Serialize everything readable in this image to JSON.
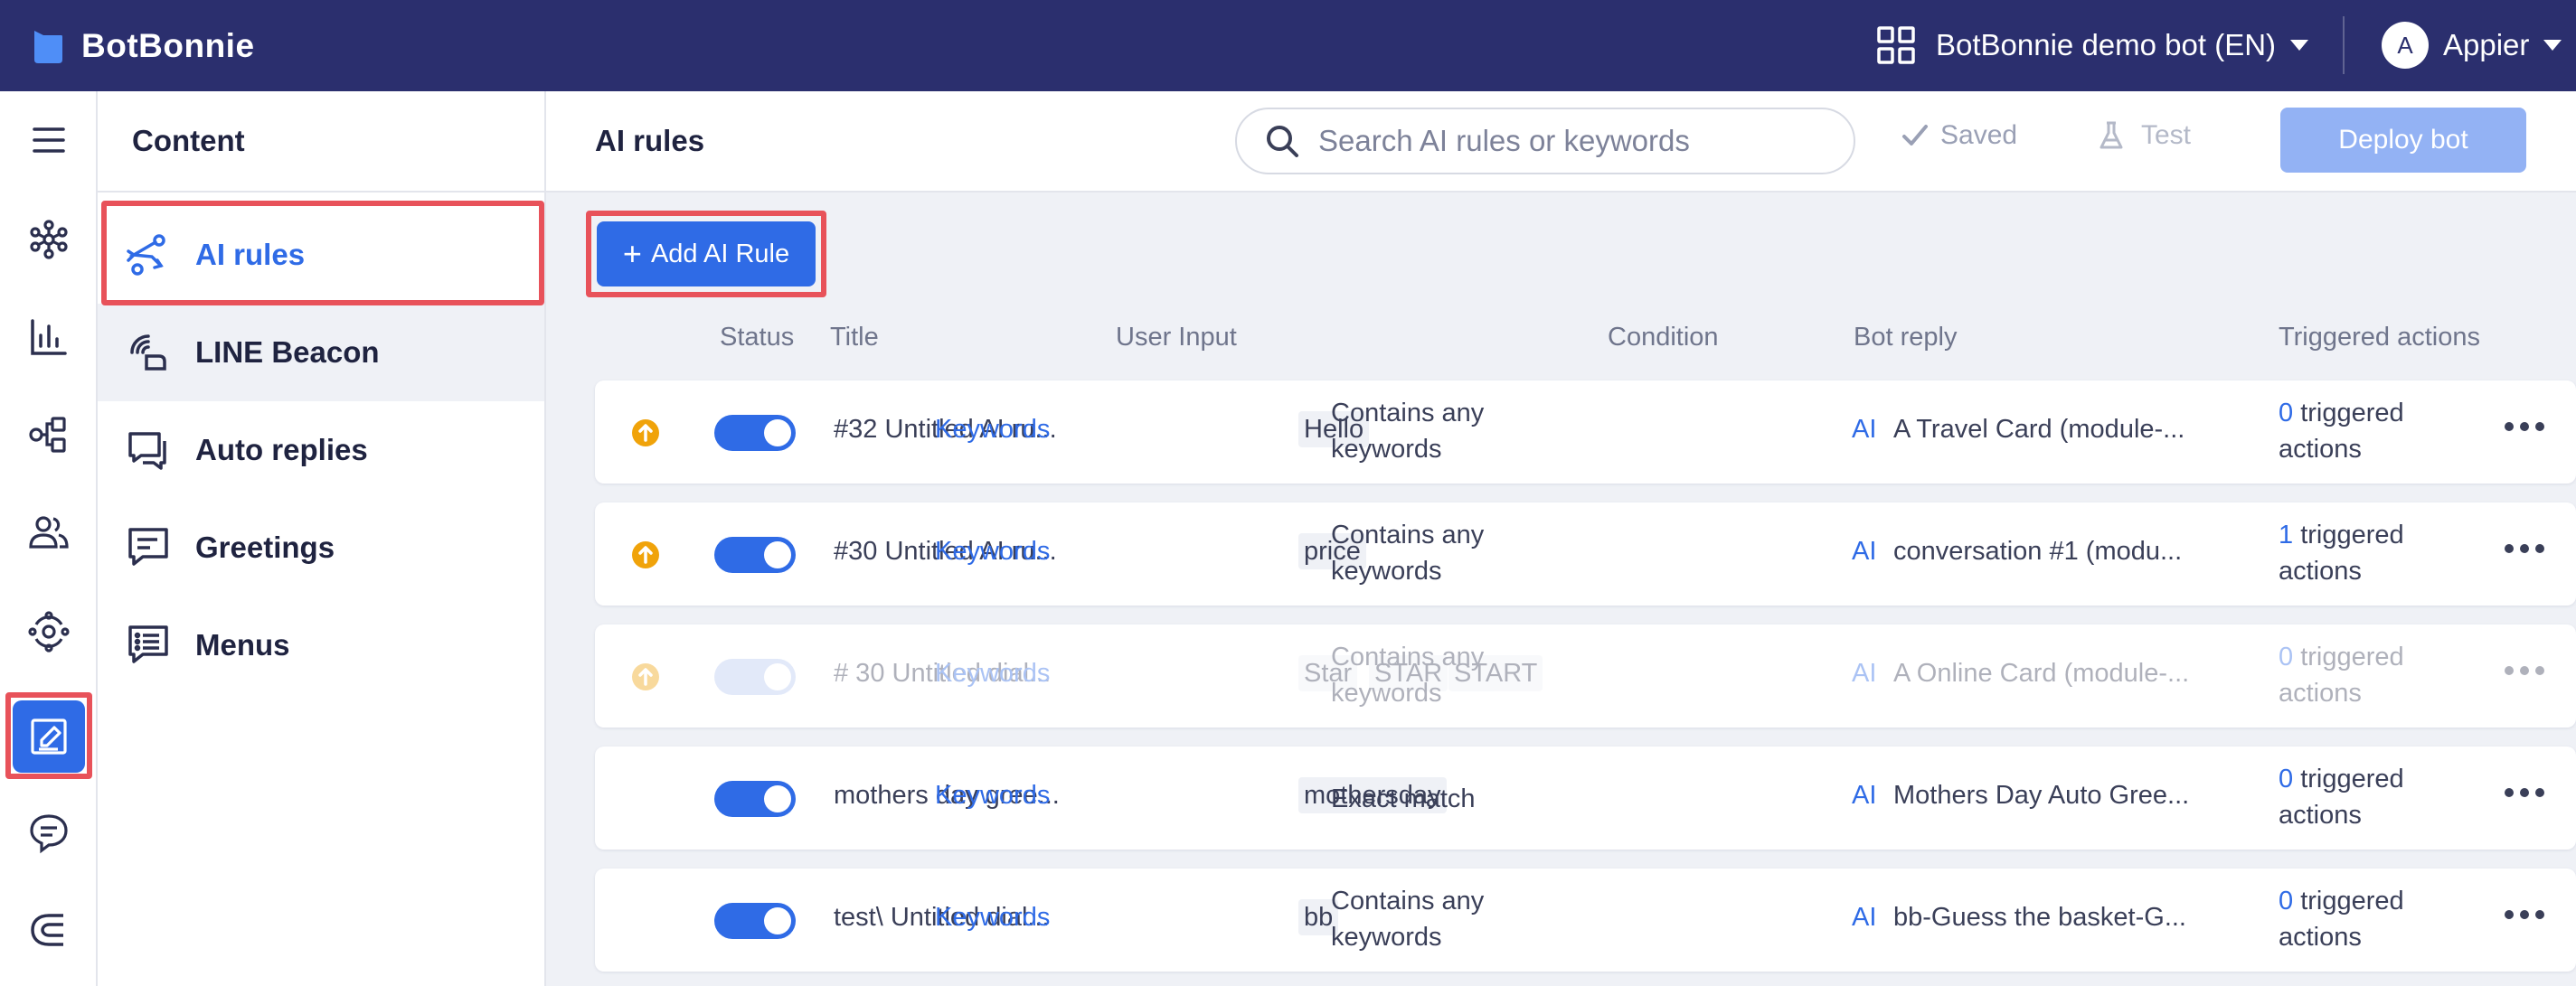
{
  "app": {
    "name": "BotBonnie"
  },
  "topbar": {
    "bot_name": "BotBonnie demo bot (EN)",
    "avatar_initial": "A",
    "account_name": "Appier"
  },
  "sidebar": {
    "title": "Content",
    "items": [
      {
        "label": "AI rules"
      },
      {
        "label": "LINE Beacon"
      },
      {
        "label": "Auto replies"
      },
      {
        "label": "Greetings"
      },
      {
        "label": "Menus"
      }
    ]
  },
  "header": {
    "title": "AI rules",
    "search_placeholder": "Search AI rules or keywords",
    "saved_label": "Saved",
    "test_label": "Test",
    "deploy_label": "Deploy bot"
  },
  "toolbar": {
    "add_rule_label": "Add AI Rule",
    "add_rule_plus": "+"
  },
  "table": {
    "columns": {
      "status": "Status",
      "title": "Title",
      "user_input": "User Input",
      "condition": "Condition",
      "bot_reply": "Bot reply",
      "triggered": "Triggered actions"
    },
    "rows": [
      {
        "title": "#32 Untitled AI ru...",
        "input_type": "Keywords",
        "keywords": [
          "Hello"
        ],
        "condition": "Contains any keywords",
        "reply_type": "AI",
        "reply": "A Travel Card (module-...",
        "triggered_count": "0",
        "triggered_label": "triggered actions"
      },
      {
        "title": "#30 Untitled AI ru...",
        "input_type": "Keywords",
        "keywords": [
          "price"
        ],
        "condition": "Contains any keywords",
        "reply_type": "AI",
        "reply": "conversation #1 (modu...",
        "triggered_count": "1",
        "triggered_label": "triggered actions"
      },
      {
        "title": "# 30 Untitled dial...",
        "input_type": "Keywords",
        "keywords": [
          "Star",
          "STAR",
          "START"
        ],
        "condition": "Contains any keywords",
        "reply_type": "AI",
        "reply": "A Online Card (module-...",
        "triggered_count": "0",
        "triggered_label": "triggered actions"
      },
      {
        "title": "mothers day gree...",
        "input_type": "Keywords",
        "keywords": [
          "mothersday"
        ],
        "condition": "Exact match",
        "reply_type": "AI",
        "reply": "Mothers Day Auto Gree...",
        "triggered_count": "0",
        "triggered_label": "triggered actions"
      },
      {
        "title": "test\\ Untitled dial...",
        "input_type": "Keywords",
        "keywords": [
          "bb"
        ],
        "condition": "Contains any keywords",
        "reply_type": "AI",
        "reply": "bb-Guess the basket-G...",
        "triggered_count": "0",
        "triggered_label": "triggered actions"
      }
    ]
  },
  "colors": {
    "topbar": "#2b2f6e",
    "accent": "#2f6be6",
    "highlight": "#e8525a",
    "priority": "#f0a30a",
    "deploy_disabled": "#93b2f4"
  },
  "icons": {
    "rail": [
      "hamburger-icon",
      "network-icon",
      "chart-icon",
      "flow-icon",
      "users-icon",
      "sync-icon",
      "edit-icon",
      "chat-icon",
      "magnet-icon"
    ],
    "sidebar": [
      "route-icon",
      "beacon-icon",
      "auto-reply-icon",
      "greeting-icon",
      "menu-icon"
    ],
    "priority": "arrow-up-circle-icon"
  }
}
